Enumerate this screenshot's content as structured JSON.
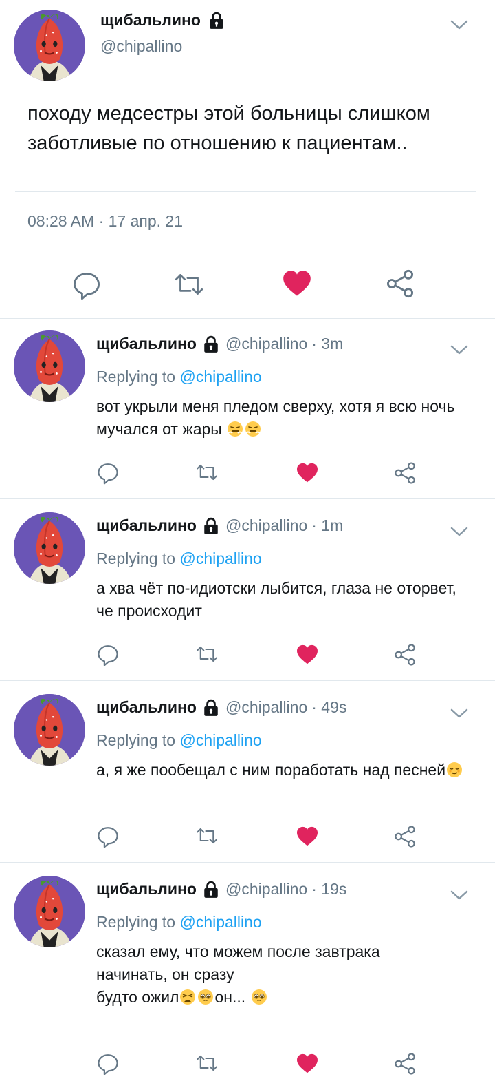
{
  "main_tweet": {
    "display_name": "щибальлино",
    "handle": "@chipallino",
    "text": "походу медсестры этой больницы слишком заботливые по отношению к пациентам..",
    "timestamp": "08:28 AM · 17 апр. 21",
    "icons": {
      "reply": "reply-icon",
      "retweet": "retweet-icon",
      "like": "heart-icon",
      "share": "share-icon"
    },
    "colors": {
      "like": "#e0245e",
      "muted": "#657786",
      "link": "#1da1f2",
      "avatar_bg": "#6a55b6"
    }
  },
  "replies": [
    {
      "display_name": "щибальлино",
      "handle": "@chipallino",
      "time": "· 3m",
      "replying_prefix": "Replying to",
      "replying_to": "@chipallino",
      "text": "вот укрыли меня пледом сверху, хотя я всю ночь мучался от жары",
      "emojis": [
        "steam-face-emoji",
        "steam-face-emoji"
      ]
    },
    {
      "display_name": "щибальлино",
      "handle": "@chipallino",
      "time": "· 1m",
      "replying_prefix": "Replying to",
      "replying_to": "@chipallino",
      "text": "а хва чёт по-идиотски лыбится, глаза не оторвет, че происходит",
      "emojis": []
    },
    {
      "display_name": "щибальлино",
      "handle": "@chipallino",
      "time": "· 49s",
      "replying_prefix": "Replying to",
      "replying_to": "@chipallino",
      "text": "а, я же пообещал с ним поработать над песней",
      "emojis": [
        "relieved-face-emoji"
      ]
    },
    {
      "display_name": "щибальлино",
      "handle": "@chipallino",
      "time": "· 19s",
      "replying_prefix": "Replying to",
      "replying_to": "@chipallino",
      "text_line1": "сказал ему, что можем после завтрака начинать, он сразу",
      "text_line2a": "будто ожил",
      "text_line2b": "он...",
      "emojis": [
        "weary-face-emoji",
        "pleading-face-emoji",
        "pleading-face-emoji"
      ]
    }
  ]
}
